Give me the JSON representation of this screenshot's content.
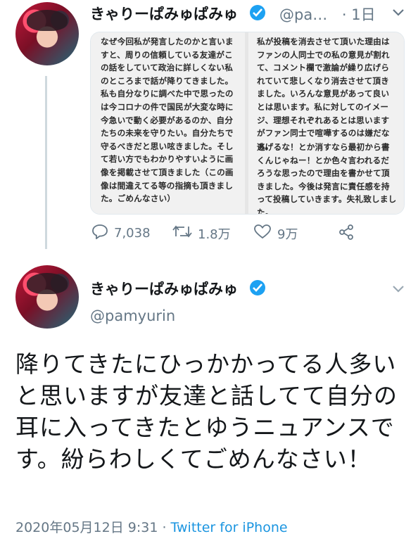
{
  "colors": {
    "link": "#1b95e0",
    "verified": "#1da1f2",
    "muted": "#657786",
    "text": "#14171a"
  },
  "quoted_tweet": {
    "display_name": "きゃりーぱみゅぱみゅ",
    "handle": "@pa…",
    "time": "· 1日",
    "image_text_left": "なぜ今回私が発言したのかと言いますと、周りの信頼している友達がこの話をしていて政治に詳しくない私のところまで話が降りてきました。私も自分なりに調べた中で思ったのは今コロナの件で国民が大変な時に今急いで動く必要があるのか、自分たちの未来を守りたい。自分たちで守るべきだと思い呟きました。そして若い方でもわかりやすいように画像を掲載させて頂きました（この画像は間違えてる等の指摘も頂きました。ごめんなさい）",
    "image_text_right_1": "私が投稿を消去させて頂いた理由はファンの人同士での私の意見が割れて、コメント欄で激論が繰り広げられていて悲しくなり消去させて頂きました。いろんな意見があって良いとは思います。私に対してのイメージ、理想それぞれあるとは思いますがファン同士で喧嘩するのは嫌だなぁ。",
    "image_text_right_2": "逃げるな！とか消すなら最初から書くんじゃねー！とか色々言われるだろうな思ったので理由を書かせて頂きました。今後は発言に責任感を持って投稿していきます。失礼致しました。",
    "stats": {
      "replies": "7,038",
      "retweets": "1.8万",
      "likes": "9万"
    },
    "icons": [
      "reply-icon",
      "retweet-icon",
      "like-icon",
      "share-icon"
    ]
  },
  "main_tweet": {
    "display_name": "きゃりーぱみゅぱみゅ",
    "handle": "@pamyurin",
    "text": "降りてきたにひっかかってる人多いと思いますが友達と話してて自分の耳に入ってきたとゆうニュアンスです。紛らわしくてごめんなさい！",
    "timestamp": "2020年05月12日 9:31 · ",
    "source": "Twitter for iPhone"
  }
}
